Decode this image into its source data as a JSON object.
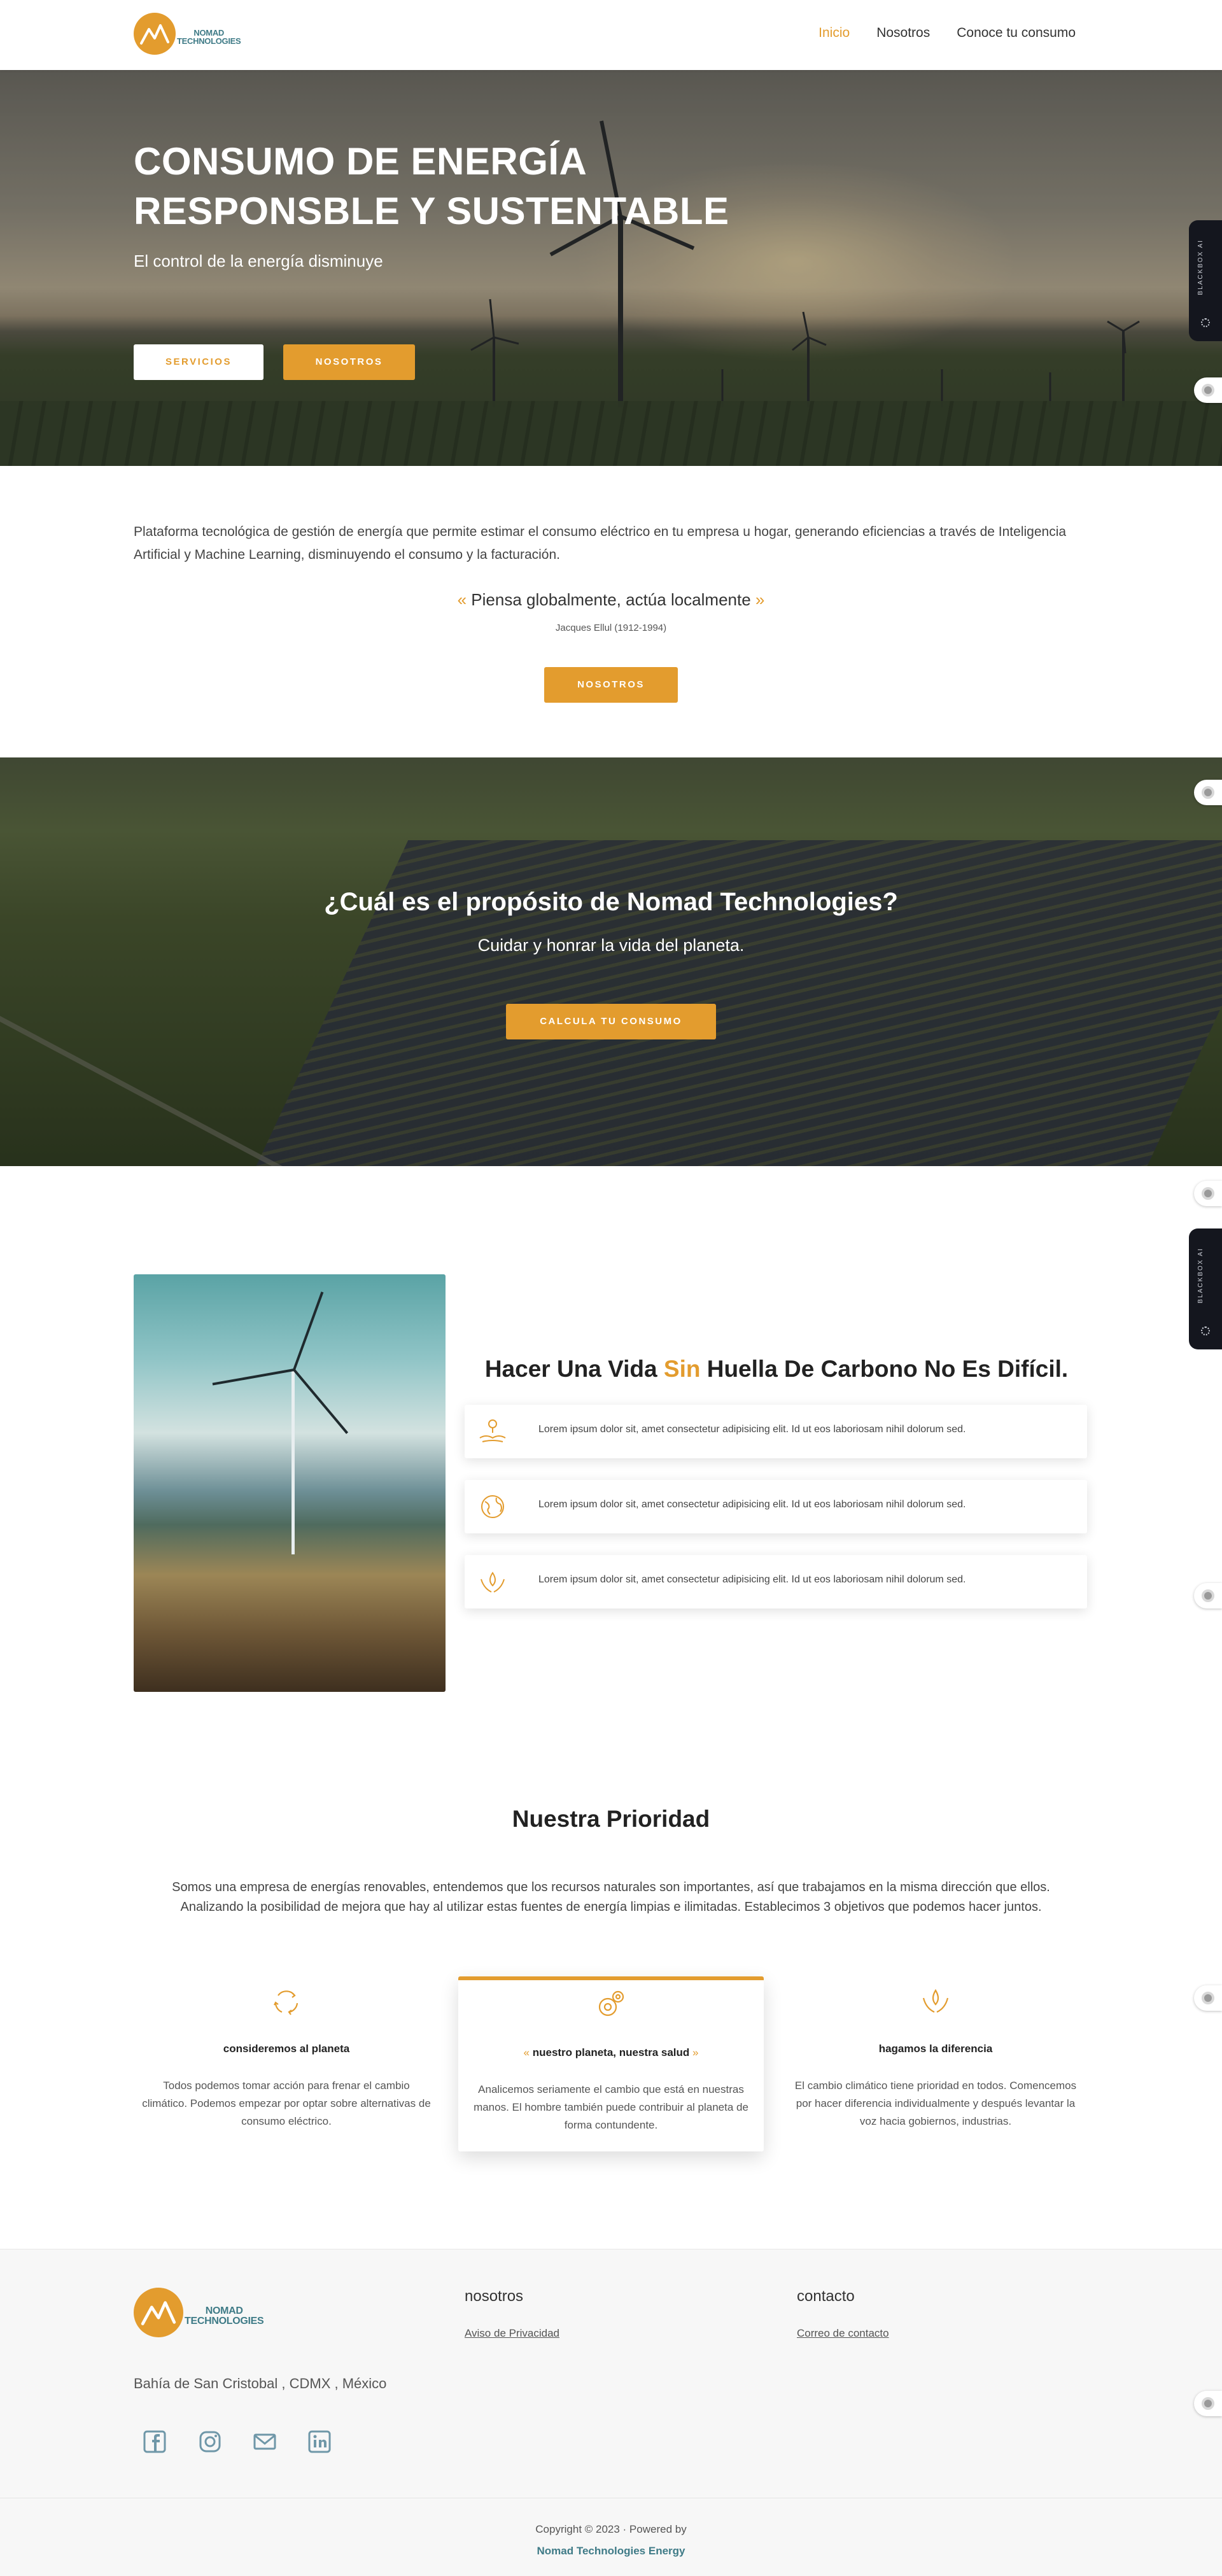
{
  "brand": {
    "name_line1": "NOMAD",
    "name_line2": "TECHNOLOGIES",
    "accent": "#e39c2e",
    "teal": "#3f7b87"
  },
  "nav": {
    "items": [
      {
        "label": "Inicio",
        "active": true
      },
      {
        "label": "Nosotros",
        "active": false
      },
      {
        "label": "Conoce tu consumo",
        "active": false
      }
    ]
  },
  "hero": {
    "title_line1": "CONSUMO DE ENERGÍA",
    "title_line2": "RESPONSBLE Y SUSTENTABLE",
    "subtitle": "El control de la energía disminuye",
    "btn_primary": "SERVICIOS",
    "btn_secondary": "NOSOTROS"
  },
  "sidebar_widget": {
    "label": "BLACKBOX AI"
  },
  "intro": {
    "text": "Plataforma tecnológica de gestión de energía que permite estimar el consumo eléctrico en tu empresa u hogar, generando eficiencias a través de Inteligencia Artificial y Machine Learning, disminuyendo el consumo y la facturación.",
    "quote_open": "«",
    "quote": "Piensa globalmente, actúa localmente",
    "quote_close": "»",
    "quote_author": "Jacques Ellul (1912-1994)",
    "button": "NOSOTROS"
  },
  "purpose": {
    "title": "¿Cuál es el propósito de Nomad Technologies?",
    "subtitle": "Cuidar y honrar la vida del planeta.",
    "button": "CALCULA TU CONSUMO"
  },
  "carbon": {
    "title_pre": "Hacer Una Vida",
    "title_highlight": "Sin",
    "title_post": "Huella De Carbono No Es Difícil.",
    "cards": [
      {
        "icon": "hand-plant-icon",
        "text": "Lorem ipsum dolor sit, amet consectetur adipisicing elit. Id ut eos laboriosam nihil dolorum sed."
      },
      {
        "icon": "globe-icon",
        "text": "Lorem ipsum dolor sit, amet consectetur adipisicing elit. Id ut eos laboriosam nihil dolorum sed."
      },
      {
        "icon": "hands-leaf-icon",
        "text": "Lorem ipsum dolor sit, amet consectetur adipisicing elit. Id ut eos laboriosam nihil dolorum sed."
      }
    ]
  },
  "priority": {
    "title": "Nuestra Prioridad",
    "text": "Somos una empresa de energías renovables, entendemos que los recursos naturales son importantes, así que trabajamos en la misma dirección que ellos. Analizando la posibilidad de mejora que hay al utilizar estas fuentes de energía limpias e ilimitadas. Establecimos 3 objetivos que podemos hacer juntos.",
    "columns": [
      {
        "icon": "recycle-icon",
        "title": "consideremos al planeta",
        "text": "Todos podemos tomar acción para frenar el cambio climático. Podemos empezar por optar sobre alternativas de consumo eléctrico."
      },
      {
        "icon": "gears-icon",
        "title": "nuestro planeta, nuestra salud",
        "text": "Analicemos seriamente el cambio que está en nuestras manos. El hombre también puede contribuir al planeta de forma contundente."
      },
      {
        "icon": "hands-leaf-icon",
        "title": "hagamos la diferencia",
        "text": "El cambio climático tiene prioridad en todos. Comencemos por hacer diferencia individualmente y después levantar la voz hacia gobiernos, industrias."
      }
    ]
  },
  "footer": {
    "col1_title": "nosotros",
    "col1_link": "Aviso de Privacidad",
    "col2_title": "contacto",
    "col2_link": "Correo de contacto",
    "address": "Bahía de San Cristobal , CDMX , México",
    "social": [
      "facebook-icon",
      "instagram-icon",
      "mail-icon",
      "linkedin-icon"
    ],
    "copyright": "Copyright © 2023 · Powered by",
    "powered_by": "Nomad Technologies Energy"
  }
}
